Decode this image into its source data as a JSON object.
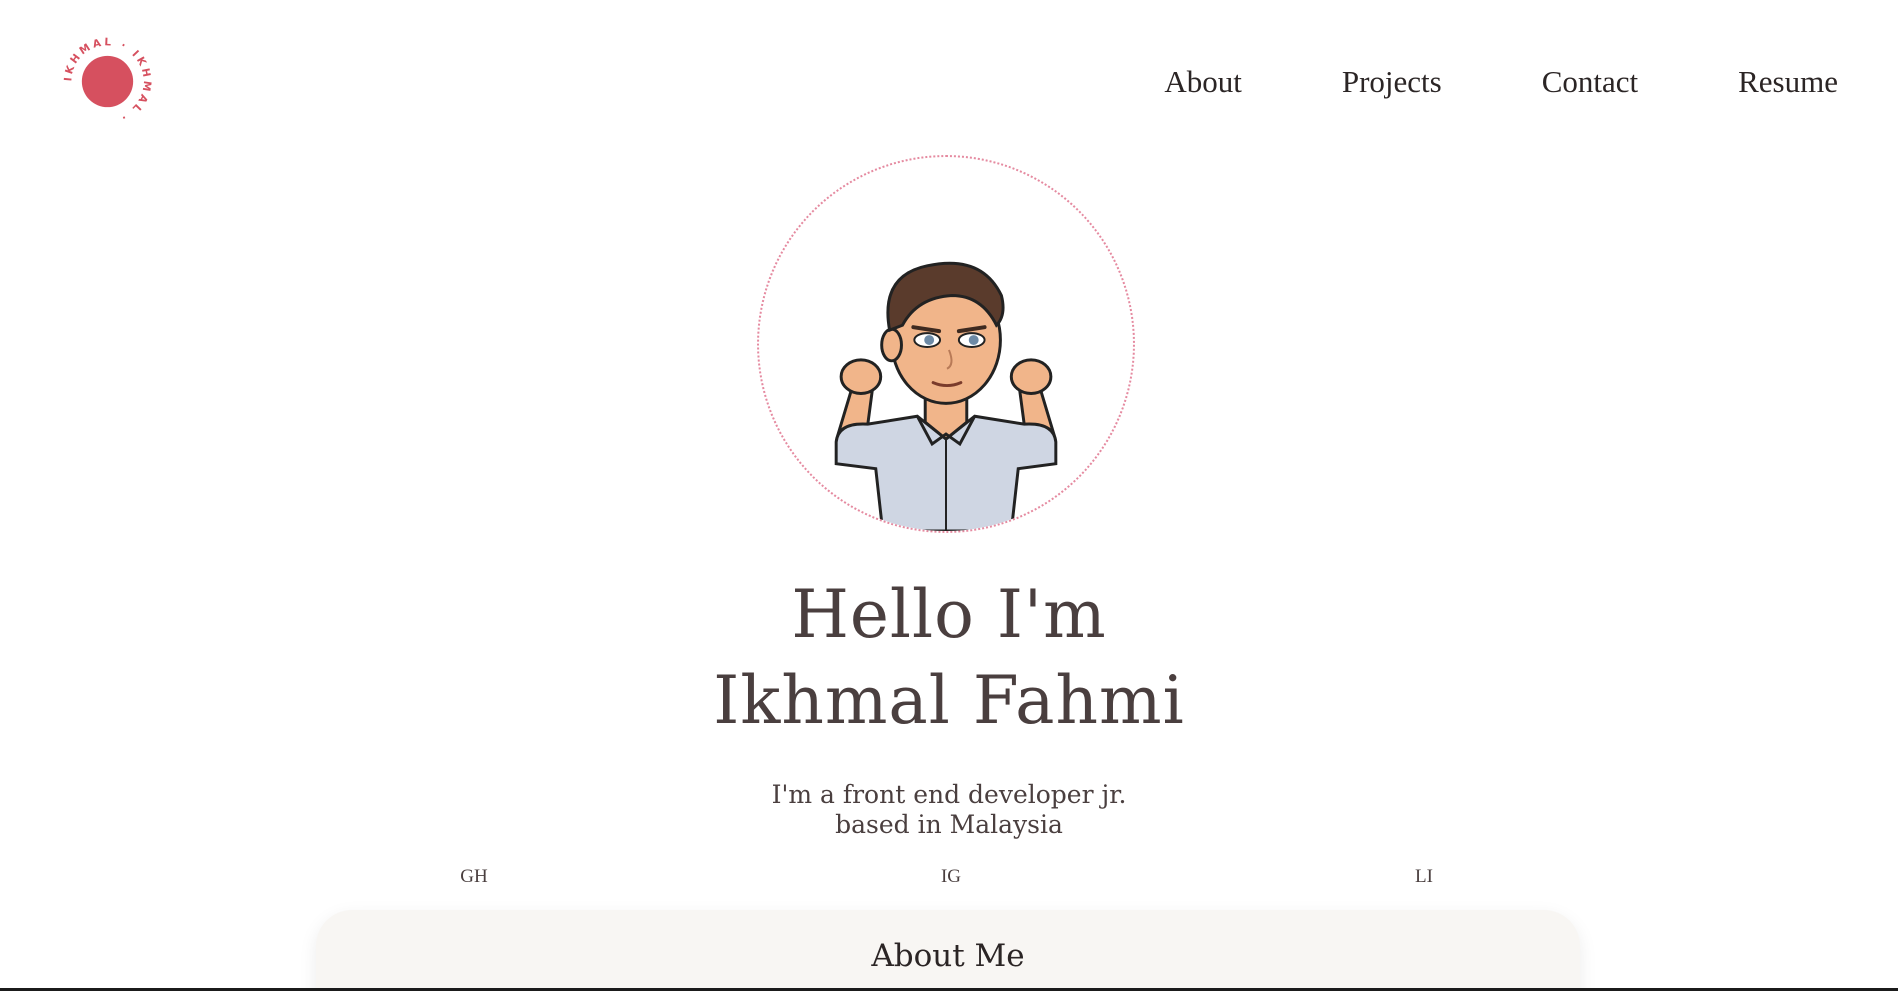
{
  "logo": {
    "ring_text": "IKHMAL · IKHMAL ·",
    "accent_color": "#d6505f"
  },
  "nav": {
    "items": [
      "About",
      "Projects",
      "Contact",
      "Resume"
    ]
  },
  "hero": {
    "avatar_icon": "bitmoji-avatar",
    "headline_line1": "Hello I'm",
    "headline_line2": "Ikhmal Fahmi",
    "subtitle_line1": "I'm a front end developer jr.",
    "subtitle_line2": "based in Malaysia"
  },
  "social": {
    "github": "GH",
    "instagram": "IG",
    "linkedin": "LI"
  },
  "about": {
    "title": "About Me"
  },
  "colors": {
    "ring": "#e58aa0",
    "text": "#4a3f3f",
    "card": "#f8f6f3"
  }
}
